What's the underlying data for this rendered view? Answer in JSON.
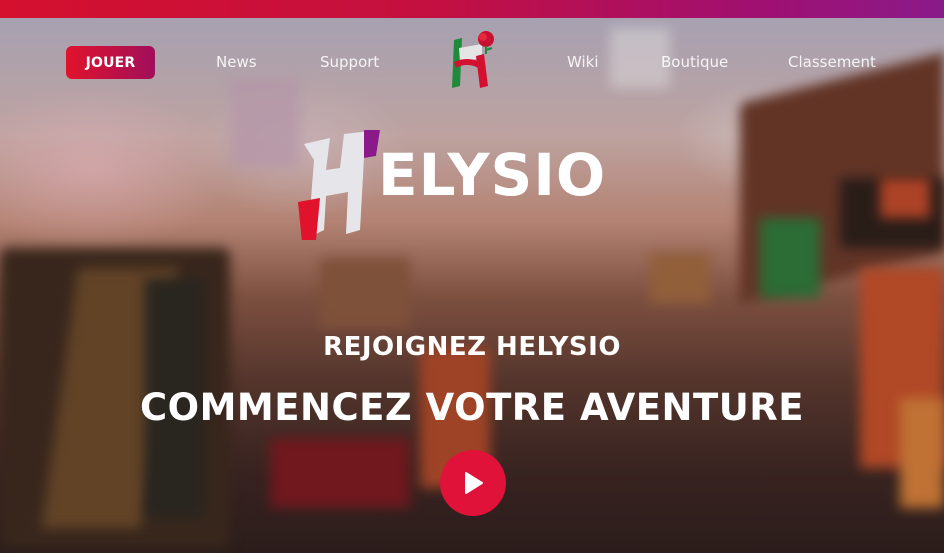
{
  "nav": {
    "cta_label": "JOUER",
    "links": [
      "News",
      "Support",
      "Wiki",
      "Boutique",
      "Classement"
    ]
  },
  "hero": {
    "brand": "ELYSIO",
    "subtitle": "REJOIGNEZ HELYSIO",
    "headline": "COMMENCEZ VOTRE AVENTURE"
  },
  "colors": {
    "accent_red": "#e0123a",
    "accent_purple": "#8a1a8a",
    "logo_green": "#1f8a3a"
  },
  "icons": {
    "logo": "rose-h-logo-icon",
    "play": "play-icon"
  }
}
